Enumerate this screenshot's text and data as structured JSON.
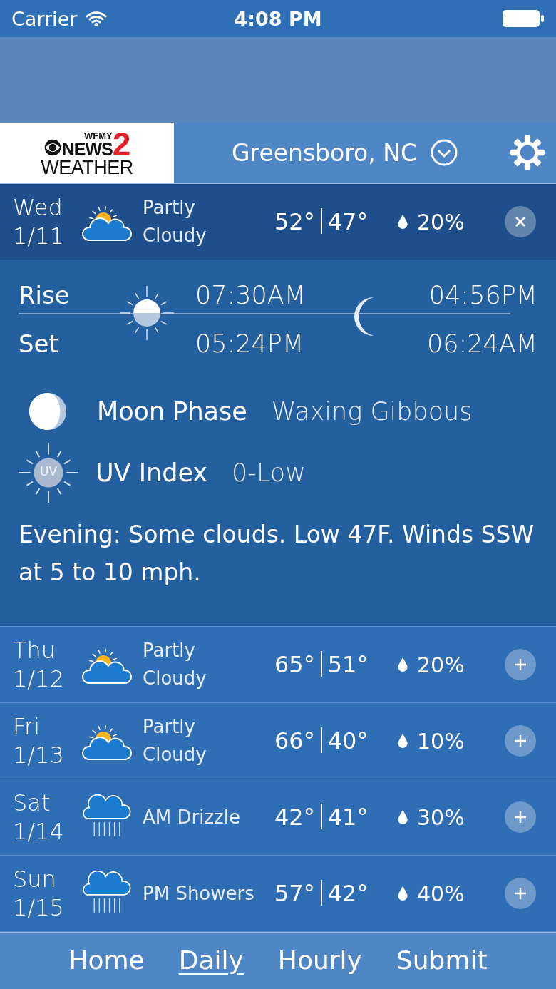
{
  "status_bar": {
    "carrier": "Carrier",
    "time": "4:08 PM"
  },
  "header": {
    "logo": {
      "top": "WFMY",
      "main": "NEWS",
      "number": "2",
      "bottom": "WEATHER"
    },
    "location": "Greensboro, NC"
  },
  "days": [
    {
      "day": "Wed",
      "date": "1/11",
      "kind": "partly-cloudy",
      "condition": "Partly Cloudy",
      "high": "52°",
      "low": "47°",
      "precip": "20%",
      "expanded": true
    },
    {
      "day": "Thu",
      "date": "1/12",
      "kind": "partly-cloudy",
      "condition": "Partly Cloudy",
      "high": "65°",
      "low": "51°",
      "precip": "20%",
      "expanded": false
    },
    {
      "day": "Fri",
      "date": "1/13",
      "kind": "partly-cloudy",
      "condition": "Partly Cloudy",
      "high": "66°",
      "low": "40°",
      "precip": "10%",
      "expanded": false
    },
    {
      "day": "Sat",
      "date": "1/14",
      "kind": "rain",
      "condition": "AM Drizzle",
      "high": "42°",
      "low": "41°",
      "precip": "30%",
      "expanded": false
    },
    {
      "day": "Sun",
      "date": "1/15",
      "kind": "rain",
      "condition": "PM Showers",
      "high": "57°",
      "low": "42°",
      "precip": "40%",
      "expanded": false
    }
  ],
  "details": {
    "rise_label": "Rise",
    "set_label": "Set",
    "sunrise": "07:30AM",
    "sunset": "05:24PM",
    "moonrise": "04:56PM",
    "moonset": "06:24AM",
    "moon_phase_label": "Moon Phase",
    "moon_phase": "Waxing Gibbous",
    "uv_label": "UV Index",
    "uv_icon_text": "UV",
    "uv_value": "0-Low",
    "forecast": "Evening: Some clouds. Low 47F. Winds SSW at 5 to 10 mph."
  },
  "tabs": [
    {
      "label": "Home",
      "selected": false
    },
    {
      "label": "Daily",
      "selected": true
    },
    {
      "label": "Hourly",
      "selected": false
    },
    {
      "label": "Submit",
      "selected": false
    }
  ]
}
